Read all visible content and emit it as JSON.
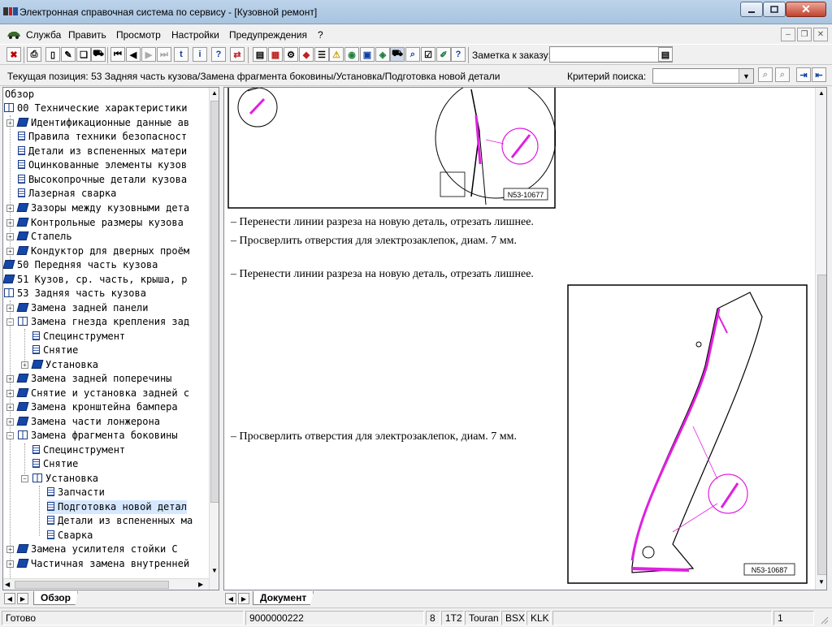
{
  "window": {
    "title": "Электронная справочная система по сервису - [Кузовной ремонт]"
  },
  "menu": [
    {
      "label": "Служба"
    },
    {
      "label": "Править"
    },
    {
      "label": "Просмотр"
    },
    {
      "label": "Настройки"
    },
    {
      "label": "Предупреждения"
    },
    {
      "label": "?"
    }
  ],
  "toolbar": {
    "note_label": "Заметка к заказу:",
    "note_value": ""
  },
  "position": {
    "text": "Текущая позиция: 53 Задняя часть кузова/Замена фрагмента боковины/Установка/Подготовка новой детали",
    "search_label": "Критерий поиска:",
    "search_value": ""
  },
  "tree": {
    "header": "Обзор",
    "items": [
      {
        "label": "00 Технические характеристики"
      },
      {
        "label": "Идентификационные данные ав"
      },
      {
        "label": "Правила техники безопасност"
      },
      {
        "label": "Детали из вспененных матери"
      },
      {
        "label": "Оцинкованные элементы кузов"
      },
      {
        "label": "Высокопрочные детали кузова"
      },
      {
        "label": "Лазерная сварка"
      },
      {
        "label": "Зазоры между кузовными дета"
      },
      {
        "label": "Контрольные размеры кузова"
      },
      {
        "label": "Стапель"
      },
      {
        "label": "Кондуктор для дверных проём"
      },
      {
        "label": "50 Передняя часть кузова"
      },
      {
        "label": "51 Кузов, ср. часть, крыша, р"
      },
      {
        "label": "53 Задняя часть кузова"
      },
      {
        "label": "Замена задней панели"
      },
      {
        "label": "Замена гнезда крепления зад"
      },
      {
        "label": "Специнструмент"
      },
      {
        "label": "Снятие"
      },
      {
        "label": "Установка"
      },
      {
        "label": "Замена задней поперечины"
      },
      {
        "label": "Снятие и установка задней с"
      },
      {
        "label": "Замена кронштейна бампера"
      },
      {
        "label": "Замена части лонжерона"
      },
      {
        "label": "Замена фрагмента боковины"
      },
      {
        "label": "Специнструмент"
      },
      {
        "label": "Снятие"
      },
      {
        "label": "Установка"
      },
      {
        "label": "Запчасти"
      },
      {
        "label": "Подготовка новой детал"
      },
      {
        "label": "Детали из вспененных ма"
      },
      {
        "label": "Сварка"
      },
      {
        "label": "Замена усилителя стойки С"
      },
      {
        "label": "Частичная замена внутренней"
      }
    ]
  },
  "document": {
    "figure1_label": "N53-10677",
    "steps": [
      "–  Перенести линии разреза на новую деталь, отрезать лишнее.",
      "–  Просверлить отверстия для электрозаклепок, диам. 7 мм.",
      "–  Перенести линии разреза на новую деталь, отрезать лишнее.",
      "–  Просверлить отверстия для электрозаклепок, диам. 7 мм."
    ],
    "figure2_label": "N53-10687"
  },
  "tabs": {
    "left": "Обзор",
    "right": "Документ"
  },
  "status": {
    "ready": "Готово",
    "order": "9000000222",
    "fields": [
      "8",
      "1T2",
      "Touran",
      "BSX",
      "KLK"
    ],
    "page": "1"
  },
  "colors": {
    "accent_line": "#e020e0",
    "selection": "#d6e8ff",
    "titlebar": "#bcd3ea"
  }
}
